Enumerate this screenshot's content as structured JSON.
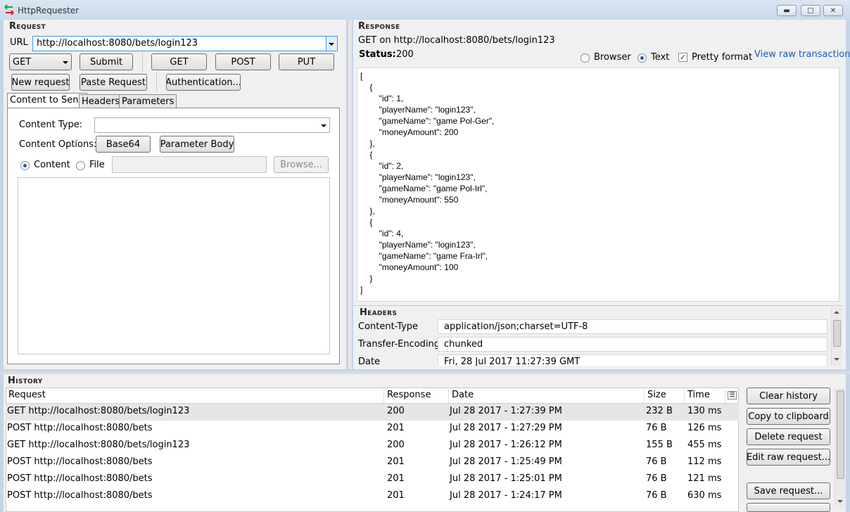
{
  "window": {
    "title": "HttpRequester"
  },
  "request": {
    "section_title": "Request",
    "url_label": "URL",
    "url_value": "http://localhost:8080/bets/login123",
    "method": "GET",
    "buttons": {
      "submit": "Submit",
      "get": "GET",
      "post": "POST",
      "put": "PUT",
      "new_request": "New request",
      "paste_request": "Paste Request",
      "authentication": "Authentication..."
    },
    "tabs": [
      "Content to Send",
      "Headers",
      "Parameters"
    ],
    "content_type_label": "Content Type:",
    "content_type_value": "",
    "content_options_label": "Content Options:",
    "base64": "Base64",
    "parameter_body": "Parameter Body",
    "radio_content": "Content",
    "radio_file": "File",
    "browse": "Browse..."
  },
  "response": {
    "section_title": "Response",
    "summary": "GET on http://localhost:8080/bets/login123",
    "status_label": "Status:",
    "status_value": "200",
    "view_browser": "Browser",
    "view_text": "Text",
    "pretty_format": "Pretty format",
    "view_raw": "View raw transaction",
    "body_lines": [
      "[",
      "    {",
      "        \"id\": 1,",
      "        \"playerName\": \"login123\",",
      "        \"gameName\": \"game Pol-Ger\",",
      "        \"moneyAmount\": 200",
      "    },",
      "    {",
      "        \"id\": 2,",
      "        \"playerName\": \"login123\",",
      "        \"gameName\": \"game Pol-Irl\",",
      "        \"moneyAmount\": 550",
      "    },",
      "    {",
      "        \"id\": 4,",
      "        \"playerName\": \"login123\",",
      "        \"gameName\": \"game Fra-Irl\",",
      "        \"moneyAmount\": 100",
      "    }",
      "]"
    ],
    "headers_title": "Headers",
    "headers": [
      {
        "name": "Content-Type",
        "value": "application/json;charset=UTF-8"
      },
      {
        "name": "Transfer-Encoding",
        "value": "chunked"
      },
      {
        "name": "Date",
        "value": "Fri, 28 Jul 2017 11:27:39 GMT"
      }
    ]
  },
  "history": {
    "section_title": "History",
    "columns": {
      "request": "Request",
      "response": "Response",
      "date": "Date",
      "size": "Size",
      "time": "Time"
    },
    "rows": [
      {
        "request": "GET http://localhost:8080/bets/login123",
        "response": "200",
        "date": "Jul 28 2017 - 1:27:39 PM",
        "size": "232 B",
        "time": "130 ms"
      },
      {
        "request": "POST http://localhost:8080/bets",
        "response": "201",
        "date": "Jul 28 2017 - 1:27:29 PM",
        "size": "76 B",
        "time": "126 ms"
      },
      {
        "request": "GET http://localhost:8080/bets/login123",
        "response": "200",
        "date": "Jul 28 2017 - 1:26:12 PM",
        "size": "155 B",
        "time": "455 ms"
      },
      {
        "request": "POST http://localhost:8080/bets",
        "response": "201",
        "date": "Jul 28 2017 - 1:25:49 PM",
        "size": "76 B",
        "time": "112 ms"
      },
      {
        "request": "POST http://localhost:8080/bets",
        "response": "201",
        "date": "Jul 28 2017 - 1:25:01 PM",
        "size": "76 B",
        "time": "121 ms"
      },
      {
        "request": "POST http://localhost:8080/bets",
        "response": "201",
        "date": "Jul 28 2017 - 1:24:17 PM",
        "size": "76 B",
        "time": "630 ms"
      }
    ],
    "buttons": {
      "clear": "Clear history",
      "copy": "Copy to clipboard",
      "delete": "Delete request",
      "edit_raw": "Edit raw request...",
      "save": "Save request..."
    }
  }
}
